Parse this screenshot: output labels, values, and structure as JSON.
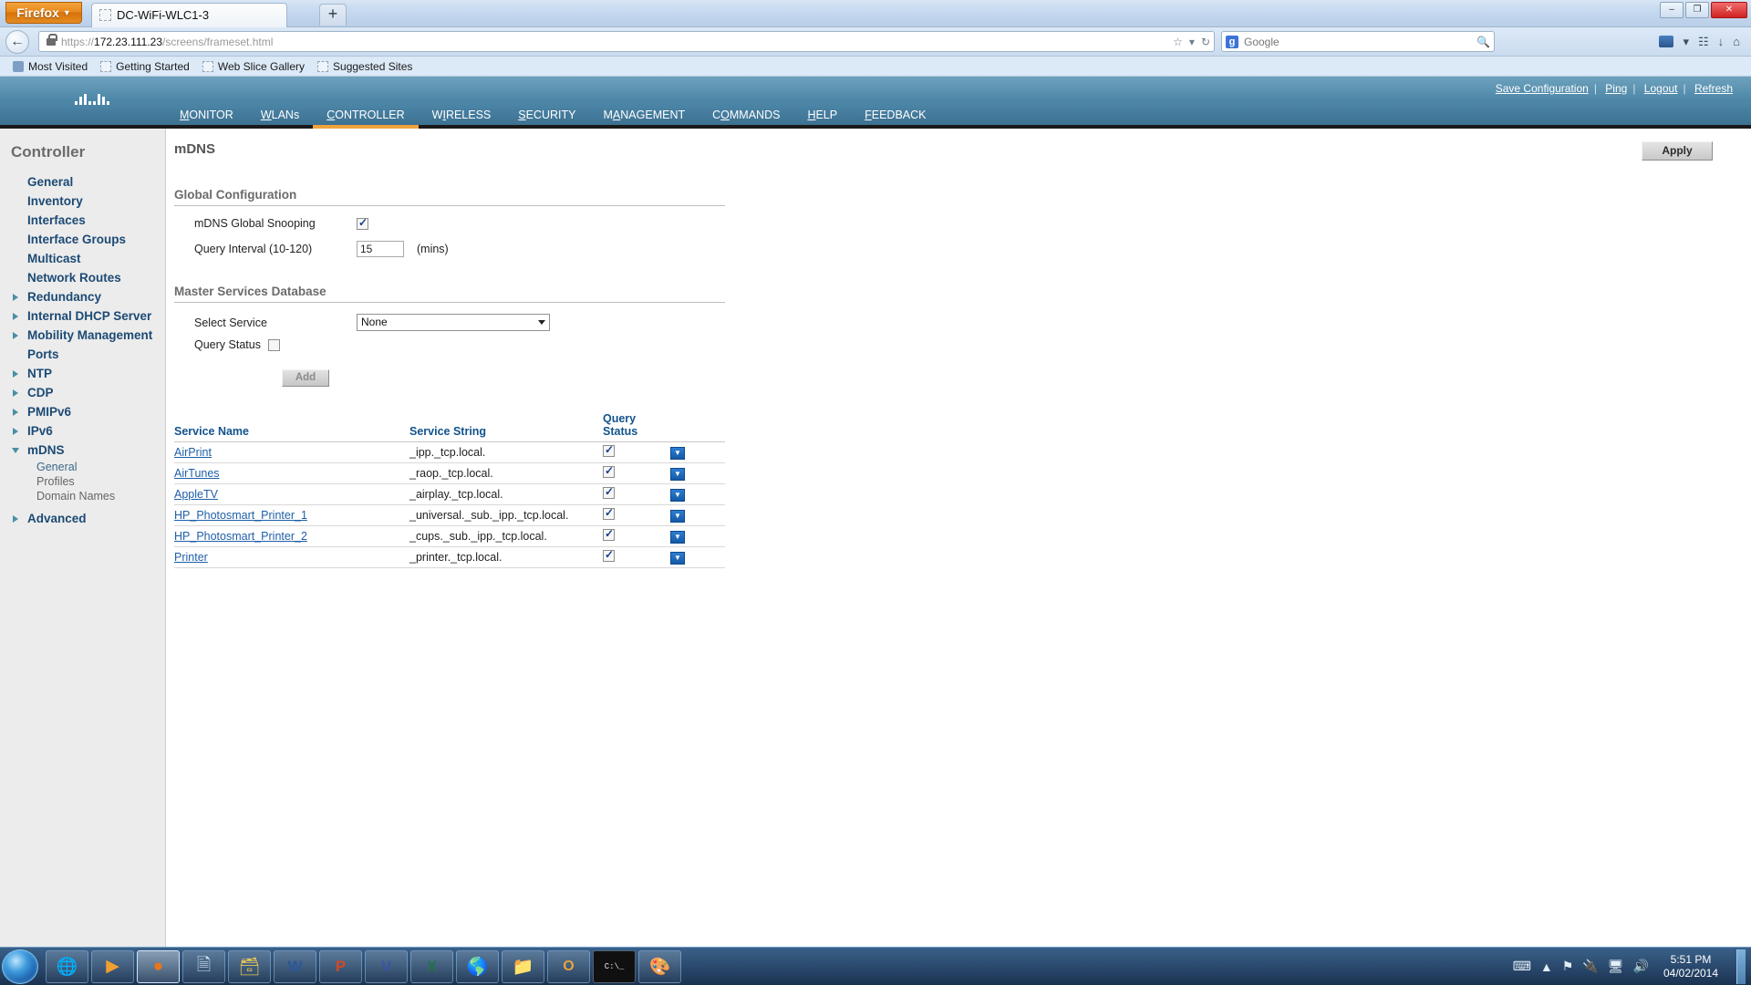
{
  "browser": {
    "app_button": "Firefox",
    "tab_title": "DC-WiFi-WLC1-3",
    "new_tab": "+",
    "url_scheme": "https://",
    "url_host": "172.23.111.23",
    "url_path": "/screens/frameset.html",
    "search_placeholder": "Google",
    "search_engine_icon": "google-icon",
    "window_minimize": "–",
    "window_maximize": "❐",
    "window_close": "✕",
    "back_icon": "←",
    "bookmarks": [
      {
        "label": "Most Visited",
        "icon": "star-icon"
      },
      {
        "label": "Getting Started",
        "icon": "page-icon"
      },
      {
        "label": "Web Slice Gallery",
        "icon": "page-icon"
      },
      {
        "label": "Suggested Sites",
        "icon": "page-icon"
      }
    ]
  },
  "cisco": {
    "logo_word": "CISCO",
    "top_links": [
      "Save Configuration",
      "Ping",
      "Logout",
      "Refresh"
    ],
    "menu": [
      {
        "label": "MONITOR",
        "accel": "M",
        "active": false
      },
      {
        "label": "WLANs",
        "accel": "W",
        "active": false
      },
      {
        "label": "CONTROLLER",
        "accel": "C",
        "active": true
      },
      {
        "label": "WIRELESS",
        "accel": "I",
        "active": false
      },
      {
        "label": "SECURITY",
        "accel": "S",
        "active": false
      },
      {
        "label": "MANAGEMENT",
        "accel": "A",
        "active": false
      },
      {
        "label": "COMMANDS",
        "accel": "O",
        "active": false
      },
      {
        "label": "HELP",
        "accel": "H",
        "active": false
      },
      {
        "label": "FEEDBACK",
        "accel": "F",
        "active": false
      }
    ],
    "accent_color": "#f0a23c",
    "header_color": "#4d87a8"
  },
  "sidebar": {
    "title": "Controller",
    "items": [
      {
        "label": "General",
        "expandable": false,
        "expanded": false
      },
      {
        "label": "Inventory",
        "expandable": false,
        "expanded": false
      },
      {
        "label": "Interfaces",
        "expandable": false,
        "expanded": false
      },
      {
        "label": "Interface Groups",
        "expandable": false,
        "expanded": false
      },
      {
        "label": "Multicast",
        "expandable": false,
        "expanded": false
      },
      {
        "label": "Network Routes",
        "expandable": false,
        "expanded": false
      },
      {
        "label": "Redundancy",
        "expandable": true,
        "expanded": false
      },
      {
        "label": "Internal DHCP Server",
        "expandable": true,
        "expanded": false
      },
      {
        "label": "Mobility Management",
        "expandable": true,
        "expanded": false
      },
      {
        "label": "Ports",
        "expandable": false,
        "expanded": false
      },
      {
        "label": "NTP",
        "expandable": true,
        "expanded": false
      },
      {
        "label": "CDP",
        "expandable": true,
        "expanded": false
      },
      {
        "label": "PMIPv6",
        "expandable": true,
        "expanded": false
      },
      {
        "label": "IPv6",
        "expandable": true,
        "expanded": false
      },
      {
        "label": "mDNS",
        "expandable": true,
        "expanded": true
      },
      {
        "label": "Advanced",
        "expandable": true,
        "expanded": false
      }
    ],
    "mdns_children": [
      "General",
      "Profiles",
      "Domain Names"
    ]
  },
  "main": {
    "page_title": "mDNS",
    "apply_label": "Apply",
    "global_section": {
      "heading": "Global Configuration",
      "snooping_label": "mDNS Global Snooping",
      "snooping_checked": true,
      "query_interval_label": "Query Interval (10-120)",
      "query_interval_value": "15",
      "query_interval_unit": "(mins)"
    },
    "master_section": {
      "heading": "Master Services Database",
      "select_service_label": "Select Service",
      "select_service_value": "None",
      "query_status_label": "Query Status",
      "query_status_checked": false,
      "add_label": "Add"
    },
    "table": {
      "headers": [
        "Service Name",
        "Service String",
        "Query Status",
        ""
      ],
      "query_status_header_line1": "Query",
      "query_status_header_line2": "Status",
      "rows": [
        {
          "name": "AirPrint",
          "string": "_ipp._tcp.local.",
          "query_status": true,
          "action_icon": "chevron-down-icon"
        },
        {
          "name": "AirTunes",
          "string": "_raop._tcp.local.",
          "query_status": true,
          "action_icon": "chevron-down-icon"
        },
        {
          "name": "AppleTV",
          "string": "_airplay._tcp.local.",
          "query_status": true,
          "action_icon": "chevron-down-icon"
        },
        {
          "name": "HP_Photosmart_Printer_1",
          "string": "_universal._sub._ipp._tcp.local.",
          "query_status": true,
          "action_icon": "chevron-down-icon"
        },
        {
          "name": "HP_Photosmart_Printer_2",
          "string": "_cups._sub._ipp._tcp.local.",
          "query_status": true,
          "action_icon": "chevron-down-icon"
        },
        {
          "name": "Printer",
          "string": "_printer._tcp.local.",
          "query_status": true,
          "action_icon": "chevron-down-icon"
        }
      ]
    }
  },
  "taskbar": {
    "start_icon": "windows-start-orb",
    "items": [
      {
        "name": "internet-explorer-icon",
        "glyph": "🌐",
        "active": false
      },
      {
        "name": "windows-media-player-icon",
        "glyph": "▶",
        "active": false
      },
      {
        "name": "firefox-icon",
        "glyph": "🦊",
        "active": true
      },
      {
        "name": "notepad-icon",
        "glyph": "🗒",
        "active": false
      },
      {
        "name": "file-explorer-icon",
        "glyph": "🗂",
        "active": false
      },
      {
        "name": "word-icon",
        "glyph": "W",
        "active": false
      },
      {
        "name": "powerpoint-icon",
        "glyph": "P",
        "active": false
      },
      {
        "name": "visio-icon",
        "glyph": "V",
        "active": false
      },
      {
        "name": "excel-icon",
        "glyph": "X",
        "active": false
      },
      {
        "name": "network-globe-icon",
        "glyph": "🌎",
        "active": false
      },
      {
        "name": "folder-icon",
        "glyph": "📁",
        "active": false
      },
      {
        "name": "outlook-icon",
        "glyph": "O",
        "active": false
      },
      {
        "name": "command-prompt-icon",
        "glyph": "C:\\_",
        "active": false
      },
      {
        "name": "paint-icon",
        "glyph": "🎨",
        "active": false
      }
    ],
    "tray_icons": [
      "keyboard-icon",
      "show-hidden-icons-icon",
      "flag-action-center-icon",
      "network-icon",
      "display-icon",
      "volume-icon"
    ],
    "time": "5:51 PM",
    "date": "04/02/2014"
  }
}
